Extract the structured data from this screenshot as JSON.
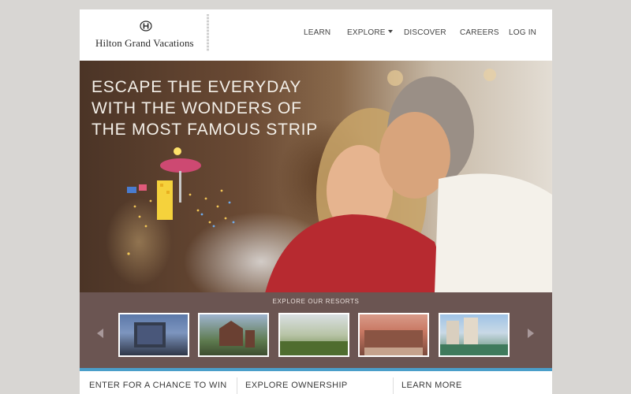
{
  "header": {
    "brand": "Hilton Grand Vacations",
    "nav": [
      {
        "label": "LEARN"
      },
      {
        "label": "EXPLORE"
      },
      {
        "label": "DISCOVER"
      },
      {
        "label": "CAREERS"
      },
      {
        "label": "LOG IN"
      }
    ]
  },
  "hero": {
    "lines": [
      "ESCAPE THE EVERYDAY",
      "WITH THE WONDERS OF",
      "THE MOST FAMOUS STRIP"
    ]
  },
  "resorts": {
    "title": "EXPLORE OUR RESORTS"
  },
  "columns": [
    {
      "label": "ENTER FOR A CHANCE TO WIN"
    },
    {
      "label": "EXPLORE OWNERSHIP"
    },
    {
      "label": "LEARN MORE"
    }
  ],
  "colors": {
    "background": "#d8d6d3",
    "resorts_band": "#6b5552",
    "accent_bar": "#4a9ec9",
    "hero_text": "#f3efe8"
  }
}
